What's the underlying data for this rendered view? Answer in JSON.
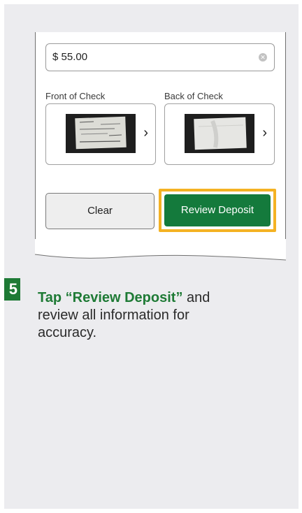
{
  "amount": {
    "value": "$ 55.00",
    "clear_icon": "clear-circle-icon"
  },
  "check": {
    "front_label": "Front of Check",
    "back_label": "Back of Check",
    "chevron": "›"
  },
  "buttons": {
    "clear_label": "Clear",
    "review_label": "Review Deposit"
  },
  "step": {
    "number": "5",
    "highlight": "Tap “Review Deposit”",
    "rest": " and review all information for accuracy."
  },
  "colors": {
    "brand_green": "#147a3c",
    "highlight_gold": "#f4b223",
    "panel_bg": "#ececef"
  }
}
